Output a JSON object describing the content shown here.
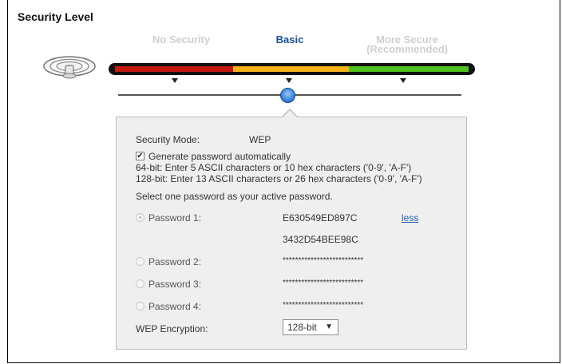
{
  "page": {
    "title": "Security Level"
  },
  "levels": [
    {
      "label_line1": "No Security",
      "label_line2": ""
    },
    {
      "label_line1": "Basic",
      "label_line2": ""
    },
    {
      "label_line1": "More Secure",
      "label_line2": "(Recommended)"
    }
  ],
  "selected_level": "Basic",
  "colors": {
    "bar_red": "#c41a12",
    "bar_yellow": "#f5b316",
    "bar_green": "#4fc21f",
    "active_level": "#1e4f8f",
    "link": "#1f5fb3"
  },
  "panel": {
    "security_mode_label": "Security Mode:",
    "security_mode_value": "WEP",
    "generate_label": "Generate password automatically",
    "generate_checked": true,
    "hint_64": "64-bit: Enter 5 ASCII characters or 10 hex characters ('0-9', 'A-F')",
    "hint_128": "128-bit: Enter 13 ASCII characters or 26 hex characters ('0-9', 'A-F')",
    "select_prompt": "Select one password as your active password.",
    "passwords": [
      {
        "label": "Password 1:",
        "value": "E630549ED897C",
        "value2": "3432D54BEE98C",
        "toggle": "less",
        "selected": true
      },
      {
        "label": "Password 2:",
        "value": "**************************",
        "selected": false
      },
      {
        "label": "Password 3:",
        "value": "**************************",
        "selected": false
      },
      {
        "label": "Password 4:",
        "value": "**************************",
        "selected": false
      }
    ],
    "encryption_label": "WEP Encryption:",
    "encryption_value": "128-bit",
    "encryption_arrow": "▼"
  },
  "icons": {
    "wifi": "wifi-router-icon",
    "checkbox_mark": "✔"
  }
}
